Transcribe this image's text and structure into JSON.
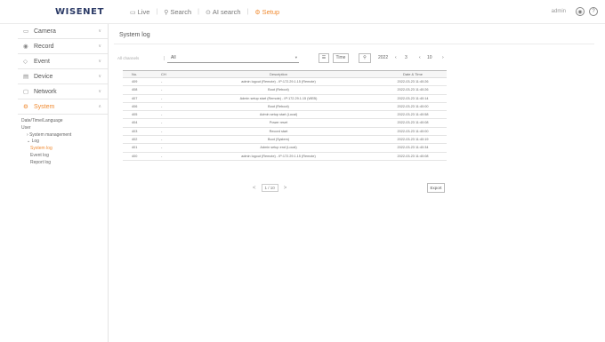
{
  "header": {
    "logo": "WISENET",
    "nav": [
      {
        "label": "Live",
        "icon": "monitor-icon",
        "active": false
      },
      {
        "label": "Search",
        "icon": "search-icon",
        "active": false
      },
      {
        "label": "AI search",
        "icon": "ai-search-icon",
        "active": false
      },
      {
        "label": "Setup",
        "icon": "gear-icon",
        "active": true
      }
    ],
    "user": "admin"
  },
  "sidebar": {
    "items": [
      {
        "label": "Camera"
      },
      {
        "label": "Record"
      },
      {
        "label": "Event"
      },
      {
        "label": "Device"
      },
      {
        "label": "Network"
      },
      {
        "label": "System"
      }
    ],
    "system_sub": {
      "date_time": "Date/Time/Language",
      "user": "User",
      "system_management": "System management",
      "log": "Log",
      "system_log": "System log",
      "event_log": "Event log",
      "report_log": "Report log"
    }
  },
  "main": {
    "title": "System log",
    "filter": {
      "label": "All channels",
      "value": "All"
    },
    "toolbar": {
      "list_icon": "list-icon",
      "time_label": "Time",
      "year": "2022",
      "page_left": "3",
      "page_right": "10"
    },
    "table": {
      "columns": [
        "No.",
        "CH",
        "Description",
        "Date & Time"
      ],
      "rows": [
        {
          "no": "409",
          "ch": "-",
          "desc": "admin logout (Remote) - IP:172.29.1.15 (Remote)",
          "date": "2022-03-23 11:40:26"
        },
        {
          "no": "408",
          "ch": "-",
          "desc": "Boot (Reboot)",
          "date": "2022-03-23 11:40:26"
        },
        {
          "no": "407",
          "ch": "-",
          "desc": "Admin setup start (Remote) - IP:172.29.1.15 (WEB)",
          "date": "2022-03-23 11:40:14"
        },
        {
          "no": "406",
          "ch": "-",
          "desc": "Boot (Reboot)",
          "date": "2022-03-23 11:40:00"
        },
        {
          "no": "405",
          "ch": "-",
          "desc": "Admin setup start (Local)",
          "date": "2022-03-23 11:40:58"
        },
        {
          "no": "404",
          "ch": "-",
          "desc": "Power reset",
          "date": "2022-03-23 11:40:08"
        },
        {
          "no": "403",
          "ch": "-",
          "desc": "Record start",
          "date": "2022-03-23 11:40:00"
        },
        {
          "no": "402",
          "ch": "-",
          "desc": "Boot (System)",
          "date": "2022-03-23 11:40:19"
        },
        {
          "no": "401",
          "ch": "-",
          "desc": "Admin setup end (Local)",
          "date": "2022-03-23 11:40:34"
        },
        {
          "no": "400",
          "ch": "-",
          "desc": "admin logout (Remote) - IP:172.29.1.15 (Remote)",
          "date": "2022-03-23 11:40:08"
        }
      ]
    },
    "pager": {
      "prev": "<",
      "page": "1 / 10",
      "next": ">"
    },
    "export_label": "Export"
  }
}
